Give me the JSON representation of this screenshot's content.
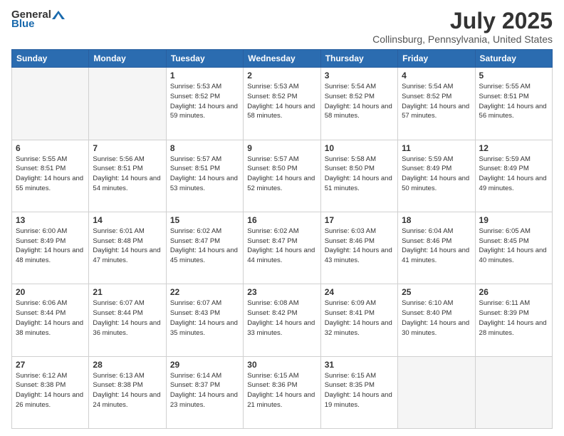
{
  "header": {
    "logo_general": "General",
    "logo_blue": "Blue",
    "main_title": "July 2025",
    "subtitle": "Collinsburg, Pennsylvania, United States"
  },
  "weekdays": [
    "Sunday",
    "Monday",
    "Tuesday",
    "Wednesday",
    "Thursday",
    "Friday",
    "Saturday"
  ],
  "weeks": [
    [
      {
        "day": "",
        "sunrise": "",
        "sunset": "",
        "daylight": ""
      },
      {
        "day": "",
        "sunrise": "",
        "sunset": "",
        "daylight": ""
      },
      {
        "day": "1",
        "sunrise": "Sunrise: 5:53 AM",
        "sunset": "Sunset: 8:52 PM",
        "daylight": "Daylight: 14 hours and 59 minutes."
      },
      {
        "day": "2",
        "sunrise": "Sunrise: 5:53 AM",
        "sunset": "Sunset: 8:52 PM",
        "daylight": "Daylight: 14 hours and 58 minutes."
      },
      {
        "day": "3",
        "sunrise": "Sunrise: 5:54 AM",
        "sunset": "Sunset: 8:52 PM",
        "daylight": "Daylight: 14 hours and 58 minutes."
      },
      {
        "day": "4",
        "sunrise": "Sunrise: 5:54 AM",
        "sunset": "Sunset: 8:52 PM",
        "daylight": "Daylight: 14 hours and 57 minutes."
      },
      {
        "day": "5",
        "sunrise": "Sunrise: 5:55 AM",
        "sunset": "Sunset: 8:51 PM",
        "daylight": "Daylight: 14 hours and 56 minutes."
      }
    ],
    [
      {
        "day": "6",
        "sunrise": "Sunrise: 5:55 AM",
        "sunset": "Sunset: 8:51 PM",
        "daylight": "Daylight: 14 hours and 55 minutes."
      },
      {
        "day": "7",
        "sunrise": "Sunrise: 5:56 AM",
        "sunset": "Sunset: 8:51 PM",
        "daylight": "Daylight: 14 hours and 54 minutes."
      },
      {
        "day": "8",
        "sunrise": "Sunrise: 5:57 AM",
        "sunset": "Sunset: 8:51 PM",
        "daylight": "Daylight: 14 hours and 53 minutes."
      },
      {
        "day": "9",
        "sunrise": "Sunrise: 5:57 AM",
        "sunset": "Sunset: 8:50 PM",
        "daylight": "Daylight: 14 hours and 52 minutes."
      },
      {
        "day": "10",
        "sunrise": "Sunrise: 5:58 AM",
        "sunset": "Sunset: 8:50 PM",
        "daylight": "Daylight: 14 hours and 51 minutes."
      },
      {
        "day": "11",
        "sunrise": "Sunrise: 5:59 AM",
        "sunset": "Sunset: 8:49 PM",
        "daylight": "Daylight: 14 hours and 50 minutes."
      },
      {
        "day": "12",
        "sunrise": "Sunrise: 5:59 AM",
        "sunset": "Sunset: 8:49 PM",
        "daylight": "Daylight: 14 hours and 49 minutes."
      }
    ],
    [
      {
        "day": "13",
        "sunrise": "Sunrise: 6:00 AM",
        "sunset": "Sunset: 8:49 PM",
        "daylight": "Daylight: 14 hours and 48 minutes."
      },
      {
        "day": "14",
        "sunrise": "Sunrise: 6:01 AM",
        "sunset": "Sunset: 8:48 PM",
        "daylight": "Daylight: 14 hours and 47 minutes."
      },
      {
        "day": "15",
        "sunrise": "Sunrise: 6:02 AM",
        "sunset": "Sunset: 8:47 PM",
        "daylight": "Daylight: 14 hours and 45 minutes."
      },
      {
        "day": "16",
        "sunrise": "Sunrise: 6:02 AM",
        "sunset": "Sunset: 8:47 PM",
        "daylight": "Daylight: 14 hours and 44 minutes."
      },
      {
        "day": "17",
        "sunrise": "Sunrise: 6:03 AM",
        "sunset": "Sunset: 8:46 PM",
        "daylight": "Daylight: 14 hours and 43 minutes."
      },
      {
        "day": "18",
        "sunrise": "Sunrise: 6:04 AM",
        "sunset": "Sunset: 8:46 PM",
        "daylight": "Daylight: 14 hours and 41 minutes."
      },
      {
        "day": "19",
        "sunrise": "Sunrise: 6:05 AM",
        "sunset": "Sunset: 8:45 PM",
        "daylight": "Daylight: 14 hours and 40 minutes."
      }
    ],
    [
      {
        "day": "20",
        "sunrise": "Sunrise: 6:06 AM",
        "sunset": "Sunset: 8:44 PM",
        "daylight": "Daylight: 14 hours and 38 minutes."
      },
      {
        "day": "21",
        "sunrise": "Sunrise: 6:07 AM",
        "sunset": "Sunset: 8:44 PM",
        "daylight": "Daylight: 14 hours and 36 minutes."
      },
      {
        "day": "22",
        "sunrise": "Sunrise: 6:07 AM",
        "sunset": "Sunset: 8:43 PM",
        "daylight": "Daylight: 14 hours and 35 minutes."
      },
      {
        "day": "23",
        "sunrise": "Sunrise: 6:08 AM",
        "sunset": "Sunset: 8:42 PM",
        "daylight": "Daylight: 14 hours and 33 minutes."
      },
      {
        "day": "24",
        "sunrise": "Sunrise: 6:09 AM",
        "sunset": "Sunset: 8:41 PM",
        "daylight": "Daylight: 14 hours and 32 minutes."
      },
      {
        "day": "25",
        "sunrise": "Sunrise: 6:10 AM",
        "sunset": "Sunset: 8:40 PM",
        "daylight": "Daylight: 14 hours and 30 minutes."
      },
      {
        "day": "26",
        "sunrise": "Sunrise: 6:11 AM",
        "sunset": "Sunset: 8:39 PM",
        "daylight": "Daylight: 14 hours and 28 minutes."
      }
    ],
    [
      {
        "day": "27",
        "sunrise": "Sunrise: 6:12 AM",
        "sunset": "Sunset: 8:38 PM",
        "daylight": "Daylight: 14 hours and 26 minutes."
      },
      {
        "day": "28",
        "sunrise": "Sunrise: 6:13 AM",
        "sunset": "Sunset: 8:38 PM",
        "daylight": "Daylight: 14 hours and 24 minutes."
      },
      {
        "day": "29",
        "sunrise": "Sunrise: 6:14 AM",
        "sunset": "Sunset: 8:37 PM",
        "daylight": "Daylight: 14 hours and 23 minutes."
      },
      {
        "day": "30",
        "sunrise": "Sunrise: 6:15 AM",
        "sunset": "Sunset: 8:36 PM",
        "daylight": "Daylight: 14 hours and 21 minutes."
      },
      {
        "day": "31",
        "sunrise": "Sunrise: 6:15 AM",
        "sunset": "Sunset: 8:35 PM",
        "daylight": "Daylight: 14 hours and 19 minutes."
      },
      {
        "day": "",
        "sunrise": "",
        "sunset": "",
        "daylight": ""
      },
      {
        "day": "",
        "sunrise": "",
        "sunset": "",
        "daylight": ""
      }
    ]
  ]
}
